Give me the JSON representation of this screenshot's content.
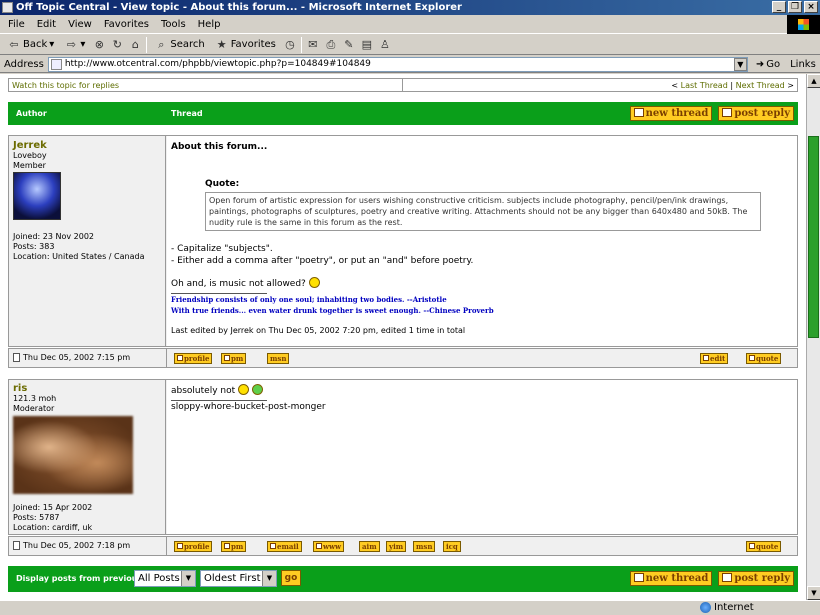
{
  "window": {
    "title": "Off Topic Central - View topic - About this forum... - Microsoft Internet Explorer"
  },
  "menu": [
    "File",
    "Edit",
    "View",
    "Favorites",
    "Tools",
    "Help"
  ],
  "toolbar": {
    "back": "Back",
    "search": "Search",
    "favorites": "Favorites"
  },
  "address": {
    "label": "Address",
    "url": "http://www.otcentral.com/phpbb/viewtopic.php?p=104849#104849",
    "go": "Go",
    "links": "Links"
  },
  "nav": {
    "watch": "Watch this topic for replies",
    "prev": "Last Thread",
    "sep": "|",
    "next": "Next Thread",
    "lt": "<",
    "gt": ">"
  },
  "header": {
    "author": "Author",
    "thread": "Thread",
    "new_thread": "new thread",
    "post_reply": "post reply"
  },
  "posts": [
    {
      "username": "Jerrek",
      "rank": "Loveboy",
      "role": "Member",
      "joined": "Joined: 23 Nov 2002",
      "posts": "Posts: 383",
      "location": "Location: United States / Canada",
      "subject": "About this forum...",
      "quote_label": "Quote:",
      "quote_text": "Open forum of artistic expression for users wishing constructive criticism. subjects include photography, pencil/pen/ink drawings, paintings, photographs of sculptures, poetry and creative writing. Attachments should not be any bigger than 640x480 and 50kB. The nudity rule is the same in this forum as the rest.",
      "line1": "- Capitalize \"subjects\".",
      "line2": "- Either add a comma after \"poetry\", or put an \"and\" before poetry.",
      "line3": "Oh and, is music not allowed?",
      "sig1": "Friendship consists of only one soul; inhabiting two bodies. --Aristotle",
      "sig2": "With true friends... even water drunk together is sweet enough. --Chinese Proverb",
      "edited": "Last edited by Jerrek on Thu Dec 05, 2002 7:20 pm, edited 1 time in total",
      "date": "Thu Dec 05, 2002 7:15 pm",
      "buttons": [
        "profile",
        "pm",
        "msn"
      ],
      "edit": "edit",
      "quote": "quote"
    },
    {
      "username": "ris",
      "rank": "121.3 moh",
      "role": "Moderator",
      "joined": "Joined: 15 Apr 2002",
      "posts": "Posts: 5787",
      "location": "Location: cardiff, uk",
      "body": "absolutely not",
      "signature": "sloppy-whore-bucket-post-monger",
      "date": "Thu Dec 05, 2002 7:18 pm",
      "buttons": [
        "profile",
        "pm",
        "email",
        "www",
        "aim",
        "yim",
        "msn",
        "icq"
      ],
      "quote": "quote"
    }
  ],
  "footer": {
    "label": "Display posts from previous:",
    "sel1": "All Posts",
    "sel2": "Oldest First",
    "go": "go"
  },
  "status": {
    "zone": "Internet"
  }
}
